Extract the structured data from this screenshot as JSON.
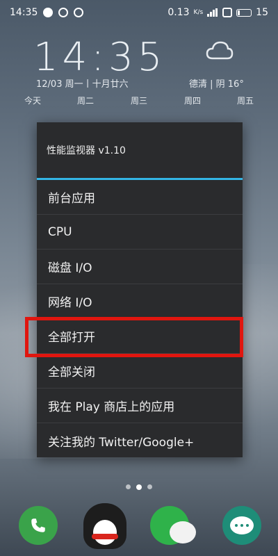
{
  "statusbar": {
    "time": "14:35",
    "network_speed": "0.13",
    "network_unit": "K/s",
    "battery_level": "15",
    "icons": [
      "weibo-icon",
      "hotspot-icon",
      "check-circle-icon",
      "signal-icon",
      "sim-icon",
      "battery-icon"
    ]
  },
  "widget": {
    "clock": "14:35",
    "date": "12/03 周一丨十月廿六",
    "location": "德清 | 阴 16°",
    "days": [
      "今天",
      "周二",
      "周三",
      "周四",
      "周五"
    ],
    "weather_icon": "cloud-icon"
  },
  "menu": {
    "title": "性能监视器 v1.10",
    "items": [
      {
        "label": "前台应用"
      },
      {
        "label": "CPU"
      },
      {
        "label": "磁盘 I/O"
      },
      {
        "label": "网络 I/O"
      },
      {
        "label": "全部打开"
      },
      {
        "label": "全部关闭"
      },
      {
        "label": "我在 Play 商店上的应用"
      },
      {
        "label": "关注我的 Twitter/Google+"
      }
    ],
    "highlighted_index": 4,
    "accent_color": "#33b5e5",
    "highlight_color": "#e0160f"
  },
  "dock": {
    "apps": [
      "phone-app",
      "qq-app",
      "wechat-app",
      "messages-app"
    ]
  }
}
